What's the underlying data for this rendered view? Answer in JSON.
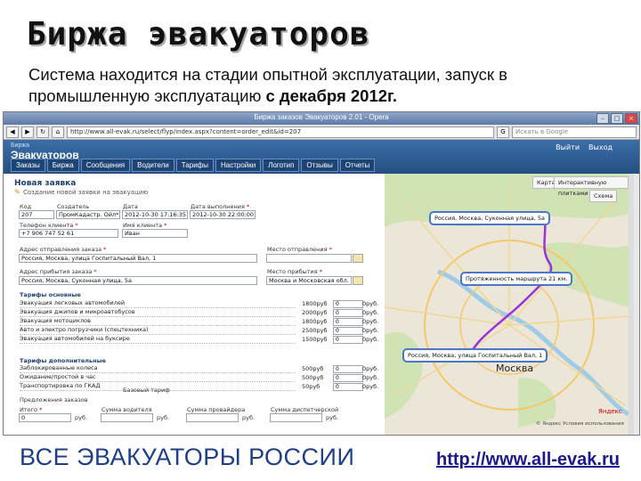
{
  "slide": {
    "title": "Биржа эвакуаторов",
    "subtitle_plain": "Система находится на стадии опытной эксплуатации, запуск в промышленную эксплуатацию ",
    "subtitle_bold": "с декабря 2012г.",
    "footer_left": "ВСЕ ЭВАКУАТОРЫ РОССИИ",
    "footer_right": "http://www.all-evak.ru"
  },
  "browser": {
    "window_title": "Биржа заказов Эвакуаторов 2.01 - Opera",
    "address": "http://www.all-evak.ru/select/flyp/index.aspx?content=order_edit&id=207",
    "search_placeholder": "Искать в Google"
  },
  "app": {
    "logo_line1": "Биржа",
    "logo_line2": "Эвакуаторов",
    "user_links": [
      "Выйти",
      "Выход"
    ],
    "menu": [
      "Заказы",
      "Биржа",
      "Сообщения",
      "Водители",
      "Тарифы",
      "Настройки",
      "Логотип",
      "Отзывы",
      "Отчеты"
    ]
  },
  "form": {
    "title": "Новая заявка",
    "subtitle": "Создание новой заявки на эвакуацию",
    "fields": {
      "code_label": "Код",
      "code_value": "207",
      "creator_label": "Создатель",
      "creator_value": "ПромКадастр. Ойл*",
      "date_label": "Дата",
      "date_value": "2012-10-30 17:16:35",
      "exec_date_label": "Дата выполнения",
      "exec_date_value": "2012-10-30 22:00:00",
      "phone_label": "Телефон клиента",
      "phone_value": "+7 906 747 52 61",
      "client_name_label": "Имя клиента",
      "client_name_value": "Иван",
      "from_label": "Адрес отправления заказа",
      "from_value": "Россия, Москва, улица Госпитальный Вал, 1",
      "from_place_label": "Место отправления",
      "to_label": "Адрес прибытия заказа",
      "to_value": "Россия, Москва, Суконная улица, 5а",
      "to_place_label": "Место прибытия",
      "to_place_value": "Москва и Московская обл."
    },
    "tariffs_title": "Тарифы основные",
    "tariffs": [
      {
        "name": "Эвакуация легковых автомобилей",
        "price": "1800руб",
        "qty": "0",
        "sum": "0руб."
      },
      {
        "name": "Эвакуация джипов и микроавтобусов",
        "price": "2000руб",
        "qty": "0",
        "sum": "0руб."
      },
      {
        "name": "Эвакуация мотоциклов",
        "price": "1800руб",
        "qty": "0",
        "sum": "0руб."
      },
      {
        "name": "Авто и электро погрузчики (спецтехника)",
        "price": "2500руб",
        "qty": "0",
        "sum": "0руб."
      },
      {
        "name": "Эвакуация автомобилей на буксире",
        "price": "1500руб",
        "qty": "0",
        "sum": "0руб."
      }
    ],
    "extra_title": "Тарифы дополнительные",
    "extras": [
      {
        "name": "Заблокированные колеса",
        "price": "500руб",
        "qty": "0",
        "sum": "0руб."
      },
      {
        "name": "Ожидание/простой в час",
        "price": "500руб",
        "qty": "0",
        "sum": "0руб."
      },
      {
        "name": "Транспортировка по ГКАД",
        "price": "50руб",
        "qty": "0",
        "sum": "0руб."
      }
    ],
    "base_tariff": "Базовый тариф",
    "suggestions_label": "Предложения заказов",
    "bottom": {
      "total_label": "Итого",
      "total_value": "0",
      "total_unit": "руб.",
      "driver_label": "Сумма водителя",
      "driver_unit": "руб.",
      "provider_label": "Сумма провайдера",
      "provider_unit": "руб.",
      "dispatcher_label": "Сумма диспетчерской",
      "dispatcher_unit": "руб."
    }
  },
  "map": {
    "tab_map": "Карта",
    "tab_route": "Интерактивную плитками",
    "scheme_label": "Схема",
    "callout_start": "Россия, Москва, Суконная улица, 5а",
    "callout_length": "Протяженность маршрута 21 км.",
    "callout_end": "Россия, Москва, улица Госпитальный Вал, 1",
    "city_label": "Москва",
    "yandex": "Яндекс",
    "copyright": "© Яндекс Условия использования"
  },
  "colors": {
    "title_text": "#111111",
    "footer_blue": "#1e3f86",
    "link_blue": "#1a1a8c",
    "app_header": "#2e5d96",
    "route": "#9b32d8"
  }
}
